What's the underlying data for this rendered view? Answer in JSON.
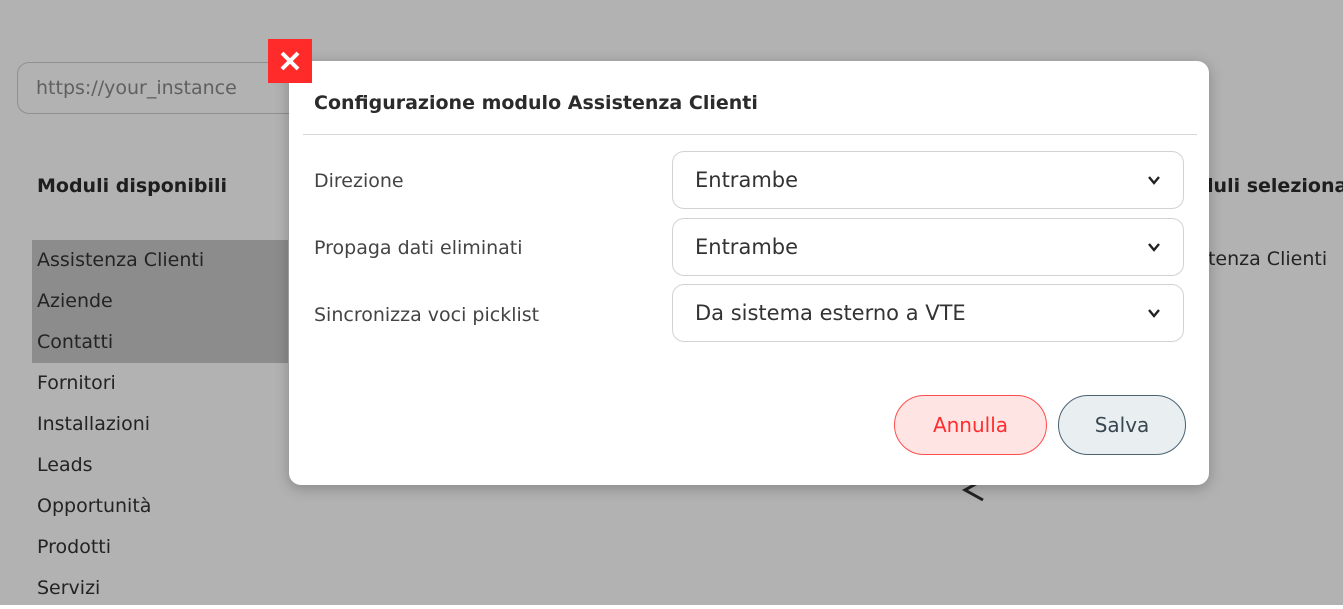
{
  "background": {
    "url_placeholder": "https://your_instance",
    "left_column_title": "Moduli disponibili",
    "right_column_title": "Moduli selezionati",
    "available_modules": [
      {
        "label": "Assistenza Clienti",
        "selected": true
      },
      {
        "label": "Aziende",
        "selected": true
      },
      {
        "label": "Contatti",
        "selected": true
      },
      {
        "label": "Fornitori",
        "selected": false
      },
      {
        "label": "Installazioni",
        "selected": false
      },
      {
        "label": "Leads",
        "selected": false
      },
      {
        "label": "Opportunità",
        "selected": false
      },
      {
        "label": "Prodotti",
        "selected": false
      },
      {
        "label": "Servizi",
        "selected": false
      }
    ],
    "selected_modules": [
      "Assistenza Clienti"
    ],
    "move_left_icon": "chevron-left-icon"
  },
  "modal": {
    "title": "Configurazione modulo Assistenza Clienti",
    "close_icon": "close-icon",
    "fields": [
      {
        "label": "Direzione",
        "value": "Entrambe"
      },
      {
        "label": "Propaga dati eliminati",
        "value": "Entrambe"
      },
      {
        "label": "Sincronizza voci picklist",
        "value": "Da sistema esterno a VTE"
      }
    ],
    "cancel_label": "Annulla",
    "save_label": "Salva"
  },
  "colors": {
    "close_bg": "#ff2b2b",
    "cancel_text": "#ff2d2d",
    "cancel_bg": "#ffe4e4",
    "save_border": "#4a6272",
    "list_selected_bg": "#c9c9c9"
  }
}
